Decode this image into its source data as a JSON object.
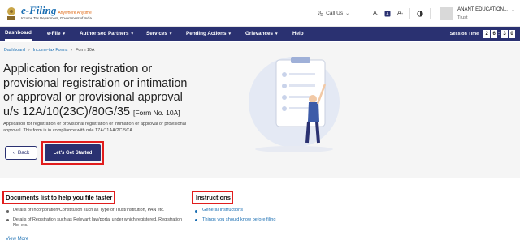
{
  "header": {
    "brand_title": "e-Filing",
    "brand_tagline": "Anywhere Anytime",
    "brand_sub": "Income Tax Department, Government of India",
    "call_label": "Call Us",
    "font_small": "A",
    "font_large": "A",
    "font_small_sup": "-",
    "font_large_sup": "+",
    "lang_icon": "language-icon",
    "contrast_icon": "contrast-icon",
    "user_name": "ANANT EDUCATION...",
    "user_role": "Trust"
  },
  "nav": {
    "items": [
      {
        "label": "Dashboard"
      },
      {
        "label": "e-File"
      },
      {
        "label": "Authorised Partners"
      },
      {
        "label": "Services"
      },
      {
        "label": "Pending Actions"
      },
      {
        "label": "Grievances"
      },
      {
        "label": "Help"
      }
    ],
    "session_label": "Session Time",
    "timer": [
      "2",
      "6",
      "3",
      "0"
    ]
  },
  "breadcrumb": {
    "items": [
      "Dashboard",
      "Income-tax Forms",
      "Form 10A"
    ]
  },
  "page": {
    "title": "Application for registration or provisional registration or intimation or approval or provisional approval u/s 12A/10(23C)/80G/35",
    "form_tag": "[Form No. 10A]",
    "description": "Application for registration or provisional registration or intimation or approval or provisional approval. This form is in compliance with rule 17A/11AA/2C/5CA.",
    "back_label": "Back",
    "start_label": "Let's Get Started"
  },
  "documents": {
    "title": "Documents list to help you file faster",
    "items": [
      "Details of Incorporation/Constitution such as Type of Trust/Institution, PAN etc.",
      "Details of Registration such as Relevant law/portal under which registered, Registration No. etc."
    ],
    "view_more": "View More"
  },
  "instructions": {
    "title": "Instructions",
    "items": [
      "General Instructions",
      "Things you should know before filing"
    ]
  },
  "colors": {
    "nav_bg": "#2a3171",
    "link": "#1b6fb3",
    "highlight": "#e11d1d"
  }
}
